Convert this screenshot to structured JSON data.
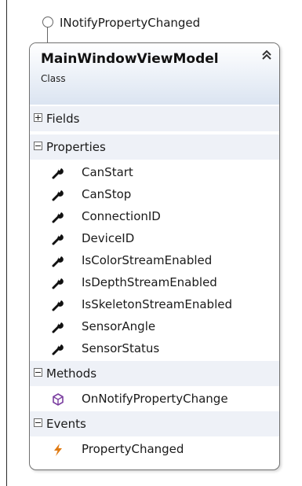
{
  "interface": {
    "name": "INotifyPropertyChanged"
  },
  "class": {
    "name": "MainWindowViewModel",
    "kind": "Class",
    "collapse_glyph": "≈"
  },
  "sections": {
    "fields": {
      "label": "Fields",
      "expanded": false
    },
    "properties": {
      "label": "Properties",
      "expanded": true,
      "items": [
        {
          "name": "CanStart",
          "icon": "wrench-icon"
        },
        {
          "name": "CanStop",
          "icon": "wrench-icon"
        },
        {
          "name": "ConnectionID",
          "icon": "wrench-icon"
        },
        {
          "name": "DeviceID",
          "icon": "wrench-icon"
        },
        {
          "name": "IsColorStreamEnabled",
          "icon": "wrench-icon"
        },
        {
          "name": "IsDepthStreamEnabled",
          "icon": "wrench-icon"
        },
        {
          "name": "IsSkeletonStreamEnabled",
          "icon": "wrench-icon"
        },
        {
          "name": "SensorAngle",
          "icon": "wrench-icon"
        },
        {
          "name": "SensorStatus",
          "icon": "wrench-icon"
        }
      ]
    },
    "methods": {
      "label": "Methods",
      "expanded": true,
      "items": [
        {
          "name": "OnNotifyPropertyChange",
          "icon": "method-cube-icon"
        }
      ]
    },
    "events": {
      "label": "Events",
      "expanded": true,
      "items": [
        {
          "name": "PropertyChanged",
          "icon": "lightning-icon"
        }
      ]
    }
  },
  "colors": {
    "header_gradient_end": "#dbe4f1",
    "section_band": "#eef1f7",
    "method_icon": "#7b3fa0",
    "event_icon": "#e07a12"
  }
}
